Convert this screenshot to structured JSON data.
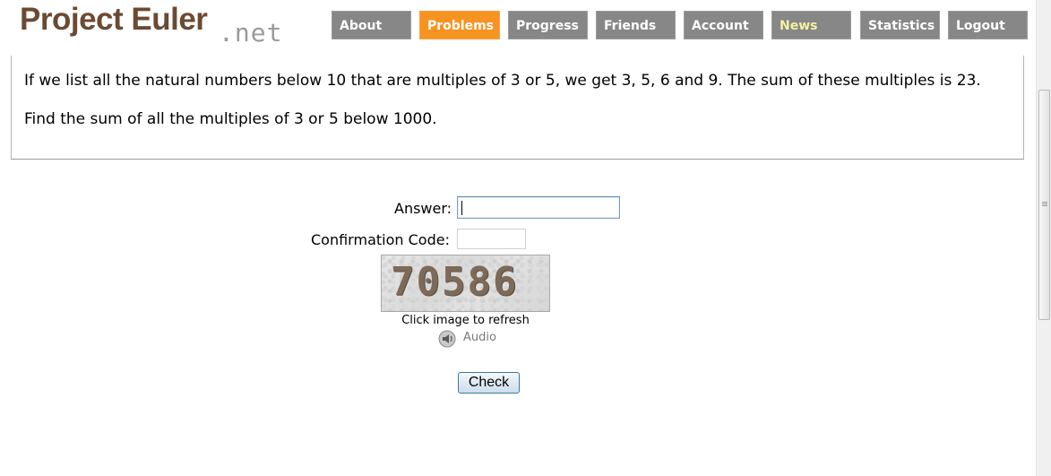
{
  "logo": {
    "main": "Project Euler",
    "sub": ".net"
  },
  "nav": [
    {
      "label": "About"
    },
    {
      "label": "Problems"
    },
    {
      "label": "Progress"
    },
    {
      "label": "Friends"
    },
    {
      "label": "Account"
    },
    {
      "label": "News"
    },
    {
      "label": "Statistics"
    },
    {
      "label": "Logout"
    }
  ],
  "colors": {
    "brand": "#6b4a33",
    "nav_bg": "#878787",
    "nav_active": "#f79321",
    "news_text": "#f4f1a0"
  },
  "problem": {
    "paragraph1": "If we list all the natural numbers below 10 that are multiples of 3 or 5, we get 3, 5, 6 and 9. The sum of these multiples is 23.",
    "paragraph2": "Find the sum of all the multiples of 3 or 5 below 1000."
  },
  "form": {
    "answer_label": "Answer:",
    "answer_value": "",
    "confirmation_label": "Confirmation Code:",
    "confirmation_value": "",
    "captcha_text": "70586",
    "refresh_text": "Click image to refresh",
    "audio_label": "Audio",
    "audio_icon": "speaker-icon",
    "check_label": "Check"
  }
}
